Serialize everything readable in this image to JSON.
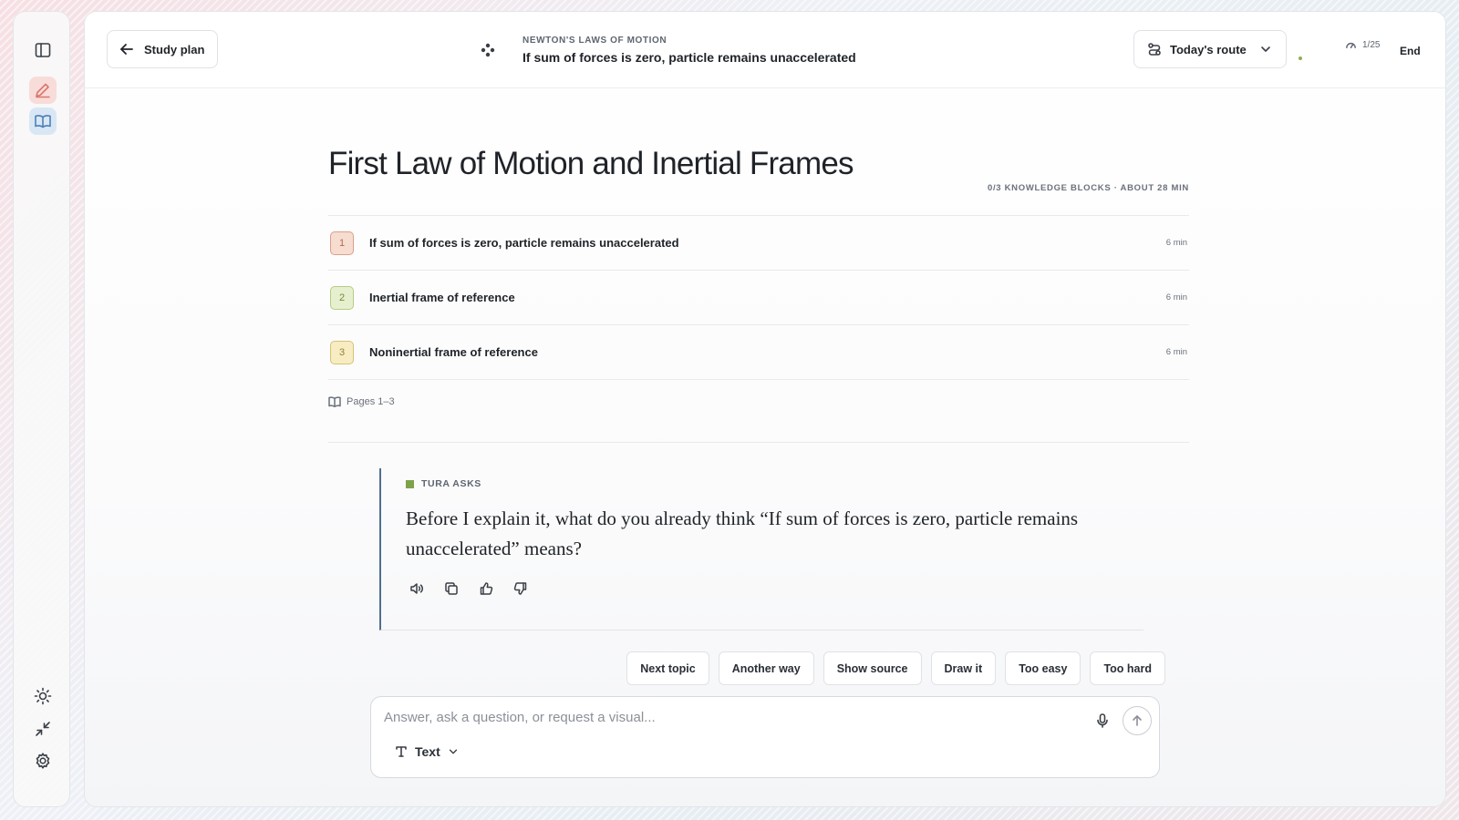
{
  "header": {
    "back_label": "Study plan",
    "kicker": "NEWTON'S LAWS OF MOTION",
    "current_topic": "If sum of forces is zero, particle remains unaccelerated",
    "route_label": "Today's route",
    "progress": "1/25",
    "end_label": "End"
  },
  "lesson": {
    "title": "First Law of Motion and Inertial Frames",
    "meta": "0/3 KNOWLEDGE BLOCKS · ABOUT 28 MIN",
    "blocks": [
      {
        "num": "1",
        "label": "If sum of forces is zero, particle remains unaccelerated",
        "time": "6 min",
        "bg": "#f7dcd0",
        "border": "#d9a08a",
        "color": "#b06a52"
      },
      {
        "num": "2",
        "label": "Inertial frame of reference",
        "time": "6 min",
        "bg": "#e6f0cf",
        "border": "#b5cc86",
        "color": "#6f8a3a"
      },
      {
        "num": "3",
        "label": "Noninertial frame of reference",
        "time": "6 min",
        "bg": "#f7ecc2",
        "border": "#d8c275",
        "color": "#9a8232"
      }
    ],
    "pages": "Pages 1–3"
  },
  "question": {
    "tag": "TURA ASKS",
    "text": "Before I explain it, what do you already think “If sum of forces is zero, particle remains unaccelerated” means?"
  },
  "chips": [
    "Next topic",
    "Another way",
    "Show source",
    "Draw it",
    "Too easy",
    "Too hard"
  ],
  "composer": {
    "placeholder": "Answer, ask a question, or request a visual...",
    "mode_label": "Text"
  },
  "colors": {
    "accent_green": "#7ea24a",
    "question_bar": "#4f6f8f"
  }
}
